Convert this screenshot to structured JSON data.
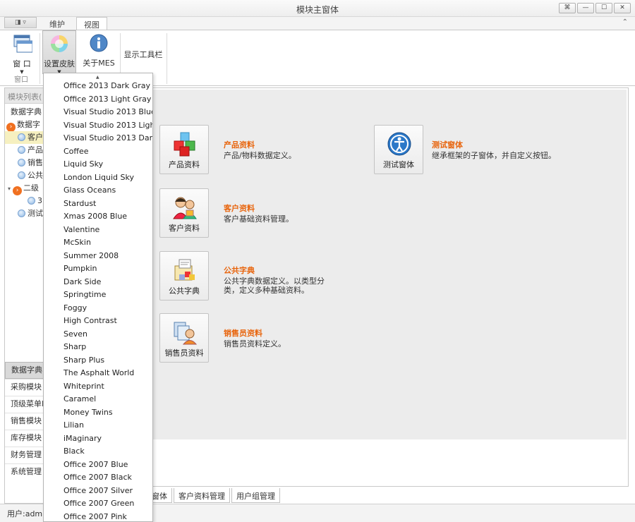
{
  "window": {
    "title": "模块主窗体",
    "buttons": [
      "⌘",
      "—",
      "☐",
      "✕"
    ]
  },
  "ribbon_tabs": {
    "app": "◨ ▿",
    "maintain": "维护",
    "view": "视图"
  },
  "ribbon": {
    "window_btn": "窗 口",
    "skin_btn": "设置皮肤",
    "about_btn": "关于MES",
    "toolbar_btn": "显示工具栏",
    "group_window": "窗口"
  },
  "left": {
    "header": "模块列表(",
    "tree": [
      "数据字典",
      "数据字",
      "客户",
      "产品",
      "销售",
      "公共",
      "二级",
      "3",
      "测试"
    ],
    "nav": [
      "数据字典",
      "采购模块",
      "顶级菜单I",
      "销售模块",
      "库存模块",
      "财务管理",
      "系统管理"
    ]
  },
  "modules": [
    {
      "tile": "产品资料",
      "title": "产品资料",
      "desc": "产品/物料数据定义。"
    },
    {
      "tile": "客户资料",
      "title": "客户资料",
      "desc": "客户基础资料管理。"
    },
    {
      "tile": "公共字典",
      "title": "公共字典",
      "desc": "公共字典数据定义。以类型分类，定义多种基础资料。"
    },
    {
      "tile": "销售员资料",
      "title": "销售员资料",
      "desc": "销售员资料定义。"
    },
    {
      "tile": "测试窗体",
      "title": "测试窗体",
      "desc": "继承框架的子窗体，并自定义按钮。"
    }
  ],
  "bottom_tabs": [
    "窗体",
    "客户资料管理",
    "用户组管理"
  ],
  "status": {
    "user": "用户:admin"
  },
  "skin_menu": [
    "Office 2013 Dark Gray",
    "Office 2013 Light Gray",
    "Visual Studio 2013 Blue",
    "Visual Studio 2013 Light",
    "Visual Studio 2013 Dark",
    "Coffee",
    "Liquid Sky",
    "London Liquid Sky",
    "Glass Oceans",
    "Stardust",
    "Xmas 2008 Blue",
    "Valentine",
    "McSkin",
    "Summer 2008",
    "Pumpkin",
    "Dark Side",
    "Springtime",
    "Foggy",
    "High Contrast",
    "Seven",
    "Sharp",
    "Sharp Plus",
    "The Asphalt World",
    "Whiteprint",
    "Caramel",
    "Money Twins",
    "Lilian",
    "iMaginary",
    "Black",
    "Office 2007 Blue",
    "Office 2007 Black",
    "Office 2007 Silver",
    "Office 2007 Green",
    "Office 2007 Pink"
  ],
  "colors": {
    "accent_orange": "#e8640c",
    "panel_bg": "#ececec"
  }
}
